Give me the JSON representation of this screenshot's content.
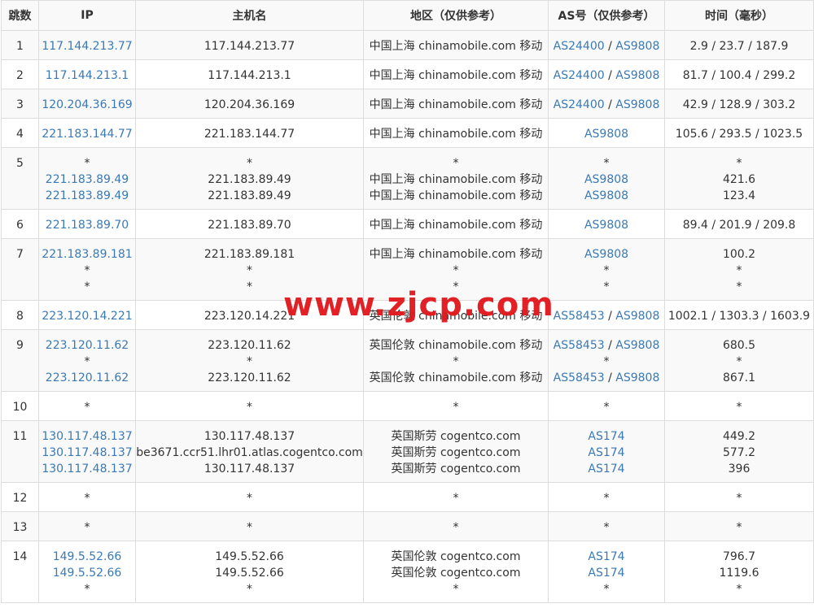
{
  "headers": {
    "hop": "跳数",
    "ip": "IP",
    "host": "主机名",
    "region": "地区（仅供参考）",
    "as": "AS号（仅供参考）",
    "time": "时间（毫秒）"
  },
  "watermark": "www.zjcp.com",
  "colors": {
    "link": "#3a79b5",
    "watermark": "#e0191d",
    "stripe": "#f9f9f9",
    "border": "#dddddd"
  },
  "rows": [
    {
      "hop": "1",
      "lines": [
        {
          "ip": "117.144.213.77",
          "host": "117.144.213.77",
          "region": "中国上海 chinamobile.com 移动",
          "as": [
            "AS24400",
            "AS9808"
          ],
          "time": "2.9 / 23.7 / 187.9"
        }
      ]
    },
    {
      "hop": "2",
      "lines": [
        {
          "ip": "117.144.213.1",
          "host": "117.144.213.1",
          "region": "中国上海 chinamobile.com 移动",
          "as": [
            "AS24400",
            "AS9808"
          ],
          "time": "81.7 / 100.4 / 299.2"
        }
      ]
    },
    {
      "hop": "3",
      "lines": [
        {
          "ip": "120.204.36.169",
          "host": "120.204.36.169",
          "region": "中国上海 chinamobile.com 移动",
          "as": [
            "AS24400",
            "AS9808"
          ],
          "time": "42.9 / 128.9 / 303.2"
        }
      ]
    },
    {
      "hop": "4",
      "lines": [
        {
          "ip": "221.183.144.77",
          "host": "221.183.144.77",
          "region": "中国上海 chinamobile.com 移动",
          "as": [
            "AS9808"
          ],
          "time": "105.6 / 293.5 / 1023.5"
        }
      ]
    },
    {
      "hop": "5",
      "lines": [
        {
          "ip": "*",
          "host": "*",
          "region": "*",
          "as": [
            "*"
          ],
          "time": "*"
        },
        {
          "ip": "221.183.89.49",
          "host": "221.183.89.49",
          "region": "中国上海 chinamobile.com 移动",
          "as": [
            "AS9808"
          ],
          "time": "421.6"
        },
        {
          "ip": "221.183.89.49",
          "host": "221.183.89.49",
          "region": "中国上海 chinamobile.com 移动",
          "as": [
            "AS9808"
          ],
          "time": "123.4"
        }
      ]
    },
    {
      "hop": "6",
      "lines": [
        {
          "ip": "221.183.89.70",
          "host": "221.183.89.70",
          "region": "中国上海 chinamobile.com 移动",
          "as": [
            "AS9808"
          ],
          "time": "89.4 / 201.9 / 209.8"
        }
      ]
    },
    {
      "hop": "7",
      "lines": [
        {
          "ip": "221.183.89.181",
          "host": "221.183.89.181",
          "region": "中国上海 chinamobile.com 移动",
          "as": [
            "AS9808"
          ],
          "time": "100.2"
        },
        {
          "ip": "*",
          "host": "*",
          "region": "*",
          "as": [
            "*"
          ],
          "time": "*"
        },
        {
          "ip": "*",
          "host": "*",
          "region": "*",
          "as": [
            "*"
          ],
          "time": "*"
        }
      ]
    },
    {
      "hop": "8",
      "lines": [
        {
          "ip": "223.120.14.221",
          "host": "223.120.14.221",
          "region": "英国伦敦 chinamobile.com 移动",
          "as": [
            "AS58453",
            "AS9808"
          ],
          "time": "1002.1 / 1303.3 / 1603.9"
        }
      ]
    },
    {
      "hop": "9",
      "lines": [
        {
          "ip": "223.120.11.62",
          "host": "223.120.11.62",
          "region": "英国伦敦 chinamobile.com 移动",
          "as": [
            "AS58453",
            "AS9808"
          ],
          "time": "680.5"
        },
        {
          "ip": "*",
          "host": "*",
          "region": "*",
          "as": [
            "*"
          ],
          "time": "*"
        },
        {
          "ip": "223.120.11.62",
          "host": "223.120.11.62",
          "region": "英国伦敦 chinamobile.com 移动",
          "as": [
            "AS58453",
            "AS9808"
          ],
          "time": "867.1"
        }
      ]
    },
    {
      "hop": "10",
      "lines": [
        {
          "ip": "*",
          "host": "*",
          "region": "*",
          "as": [
            "*"
          ],
          "time": "*"
        }
      ]
    },
    {
      "hop": "11",
      "lines": [
        {
          "ip": "130.117.48.137",
          "host": "130.117.48.137",
          "region": "英国斯劳 cogentco.com",
          "as": [
            "AS174"
          ],
          "time": "449.2"
        },
        {
          "ip": "130.117.48.137",
          "host": "be3671.ccr51.lhr01.atlas.cogentco.com",
          "region": "英国斯劳 cogentco.com",
          "as": [
            "AS174"
          ],
          "time": "577.2"
        },
        {
          "ip": "130.117.48.137",
          "host": "130.117.48.137",
          "region": "英国斯劳 cogentco.com",
          "as": [
            "AS174"
          ],
          "time": "396"
        }
      ]
    },
    {
      "hop": "12",
      "lines": [
        {
          "ip": "*",
          "host": "*",
          "region": "*",
          "as": [
            "*"
          ],
          "time": "*"
        }
      ]
    },
    {
      "hop": "13",
      "lines": [
        {
          "ip": "*",
          "host": "*",
          "region": "*",
          "as": [
            "*"
          ],
          "time": "*"
        }
      ]
    },
    {
      "hop": "14",
      "lines": [
        {
          "ip": "149.5.52.66",
          "host": "149.5.52.66",
          "region": "英国伦敦 cogentco.com",
          "as": [
            "AS174"
          ],
          "time": "796.7"
        },
        {
          "ip": "149.5.52.66",
          "host": "149.5.52.66",
          "region": "英国伦敦 cogentco.com",
          "as": [
            "AS174"
          ],
          "time": "1119.6"
        },
        {
          "ip": "*",
          "host": "*",
          "region": "*",
          "as": [
            "*"
          ],
          "time": "*"
        }
      ]
    }
  ]
}
